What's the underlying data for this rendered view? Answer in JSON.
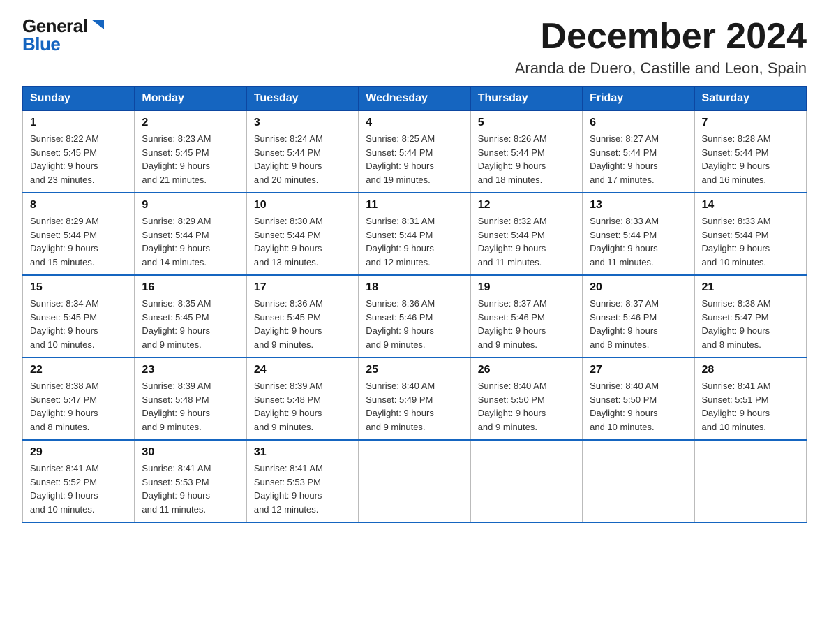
{
  "logo": {
    "general": "General",
    "blue": "Blue"
  },
  "title": "December 2024",
  "subtitle": "Aranda de Duero, Castille and Leon, Spain",
  "days_of_week": [
    "Sunday",
    "Monday",
    "Tuesday",
    "Wednesday",
    "Thursday",
    "Friday",
    "Saturday"
  ],
  "weeks": [
    [
      {
        "day": "1",
        "sunrise": "8:22 AM",
        "sunset": "5:45 PM",
        "daylight": "9 hours and 23 minutes."
      },
      {
        "day": "2",
        "sunrise": "8:23 AM",
        "sunset": "5:45 PM",
        "daylight": "9 hours and 21 minutes."
      },
      {
        "day": "3",
        "sunrise": "8:24 AM",
        "sunset": "5:44 PM",
        "daylight": "9 hours and 20 minutes."
      },
      {
        "day": "4",
        "sunrise": "8:25 AM",
        "sunset": "5:44 PM",
        "daylight": "9 hours and 19 minutes."
      },
      {
        "day": "5",
        "sunrise": "8:26 AM",
        "sunset": "5:44 PM",
        "daylight": "9 hours and 18 minutes."
      },
      {
        "day": "6",
        "sunrise": "8:27 AM",
        "sunset": "5:44 PM",
        "daylight": "9 hours and 17 minutes."
      },
      {
        "day": "7",
        "sunrise": "8:28 AM",
        "sunset": "5:44 PM",
        "daylight": "9 hours and 16 minutes."
      }
    ],
    [
      {
        "day": "8",
        "sunrise": "8:29 AM",
        "sunset": "5:44 PM",
        "daylight": "9 hours and 15 minutes."
      },
      {
        "day": "9",
        "sunrise": "8:29 AM",
        "sunset": "5:44 PM",
        "daylight": "9 hours and 14 minutes."
      },
      {
        "day": "10",
        "sunrise": "8:30 AM",
        "sunset": "5:44 PM",
        "daylight": "9 hours and 13 minutes."
      },
      {
        "day": "11",
        "sunrise": "8:31 AM",
        "sunset": "5:44 PM",
        "daylight": "9 hours and 12 minutes."
      },
      {
        "day": "12",
        "sunrise": "8:32 AM",
        "sunset": "5:44 PM",
        "daylight": "9 hours and 11 minutes."
      },
      {
        "day": "13",
        "sunrise": "8:33 AM",
        "sunset": "5:44 PM",
        "daylight": "9 hours and 11 minutes."
      },
      {
        "day": "14",
        "sunrise": "8:33 AM",
        "sunset": "5:44 PM",
        "daylight": "9 hours and 10 minutes."
      }
    ],
    [
      {
        "day": "15",
        "sunrise": "8:34 AM",
        "sunset": "5:45 PM",
        "daylight": "9 hours and 10 minutes."
      },
      {
        "day": "16",
        "sunrise": "8:35 AM",
        "sunset": "5:45 PM",
        "daylight": "9 hours and 9 minutes."
      },
      {
        "day": "17",
        "sunrise": "8:36 AM",
        "sunset": "5:45 PM",
        "daylight": "9 hours and 9 minutes."
      },
      {
        "day": "18",
        "sunrise": "8:36 AM",
        "sunset": "5:46 PM",
        "daylight": "9 hours and 9 minutes."
      },
      {
        "day": "19",
        "sunrise": "8:37 AM",
        "sunset": "5:46 PM",
        "daylight": "9 hours and 9 minutes."
      },
      {
        "day": "20",
        "sunrise": "8:37 AM",
        "sunset": "5:46 PM",
        "daylight": "9 hours and 8 minutes."
      },
      {
        "day": "21",
        "sunrise": "8:38 AM",
        "sunset": "5:47 PM",
        "daylight": "9 hours and 8 minutes."
      }
    ],
    [
      {
        "day": "22",
        "sunrise": "8:38 AM",
        "sunset": "5:47 PM",
        "daylight": "9 hours and 8 minutes."
      },
      {
        "day": "23",
        "sunrise": "8:39 AM",
        "sunset": "5:48 PM",
        "daylight": "9 hours and 9 minutes."
      },
      {
        "day": "24",
        "sunrise": "8:39 AM",
        "sunset": "5:48 PM",
        "daylight": "9 hours and 9 minutes."
      },
      {
        "day": "25",
        "sunrise": "8:40 AM",
        "sunset": "5:49 PM",
        "daylight": "9 hours and 9 minutes."
      },
      {
        "day": "26",
        "sunrise": "8:40 AM",
        "sunset": "5:50 PM",
        "daylight": "9 hours and 9 minutes."
      },
      {
        "day": "27",
        "sunrise": "8:40 AM",
        "sunset": "5:50 PM",
        "daylight": "9 hours and 10 minutes."
      },
      {
        "day": "28",
        "sunrise": "8:41 AM",
        "sunset": "5:51 PM",
        "daylight": "9 hours and 10 minutes."
      }
    ],
    [
      {
        "day": "29",
        "sunrise": "8:41 AM",
        "sunset": "5:52 PM",
        "daylight": "9 hours and 10 minutes."
      },
      {
        "day": "30",
        "sunrise": "8:41 AM",
        "sunset": "5:53 PM",
        "daylight": "9 hours and 11 minutes."
      },
      {
        "day": "31",
        "sunrise": "8:41 AM",
        "sunset": "5:53 PM",
        "daylight": "9 hours and 12 minutes."
      },
      null,
      null,
      null,
      null
    ]
  ],
  "labels": {
    "sunrise_prefix": "Sunrise: ",
    "sunset_prefix": "Sunset: ",
    "daylight_prefix": "Daylight: "
  }
}
